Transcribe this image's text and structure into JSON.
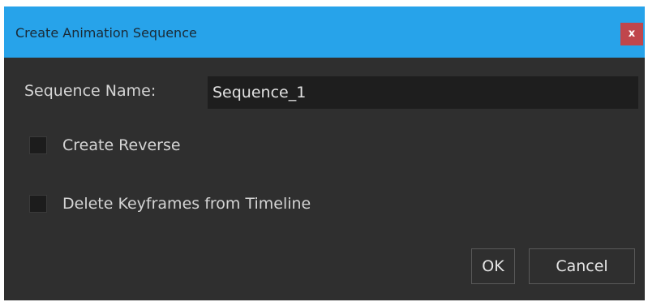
{
  "dialog": {
    "title": "Create Animation Sequence",
    "close_label": "x",
    "sequence_name_label": "Sequence Name:",
    "sequence_name_value": "Sequence_1",
    "options": [
      {
        "label": "Create Reverse",
        "checked": false
      },
      {
        "label": "Delete Keyframes from Timeline",
        "checked": false
      }
    ],
    "ok_label": "OK",
    "cancel_label": "Cancel"
  },
  "colors": {
    "titlebar": "#27a3ea",
    "body": "#2f2f2f",
    "close": "#c0464c",
    "input_bg": "#1e1e1e"
  }
}
